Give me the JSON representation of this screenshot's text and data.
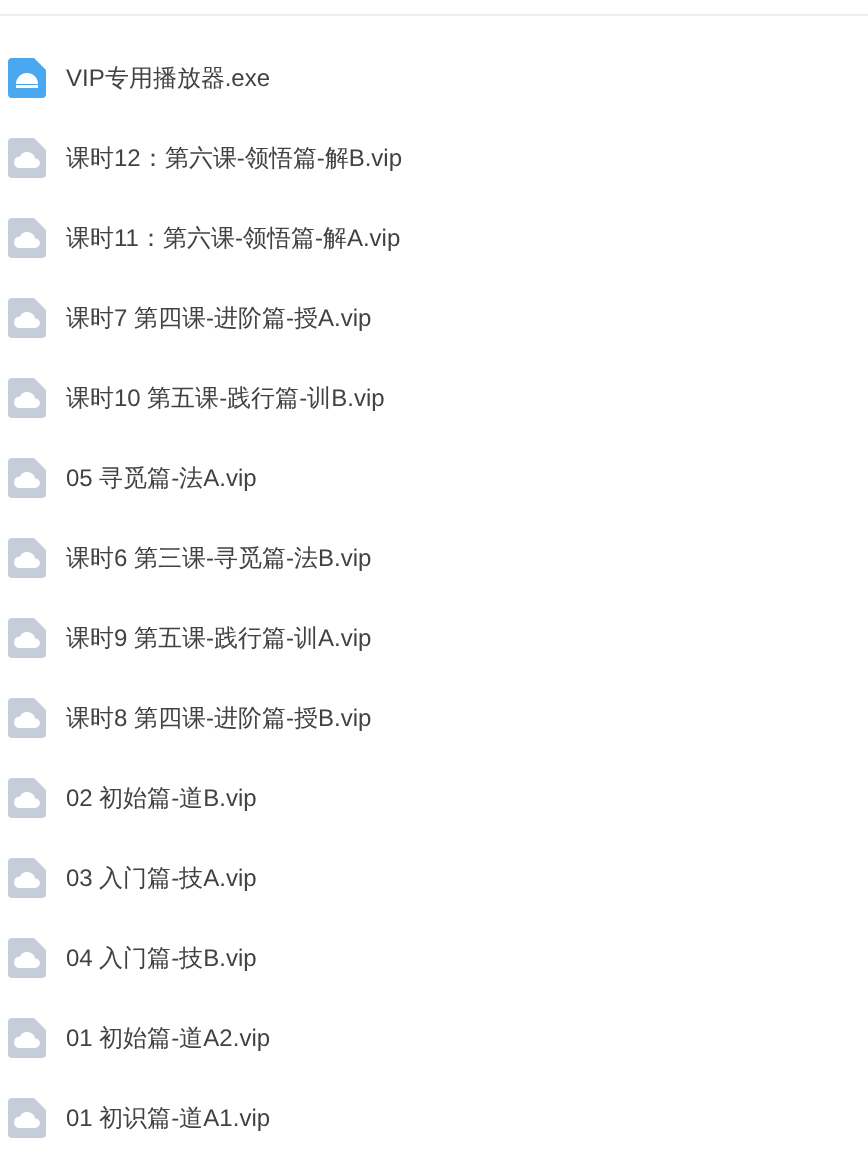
{
  "files": [
    {
      "name": "VIP专用播放器.exe",
      "kind": "app"
    },
    {
      "name": "课时12：第六课-领悟篇-解B.vip",
      "kind": "file"
    },
    {
      "name": "课时11：第六课-领悟篇-解A.vip",
      "kind": "file"
    },
    {
      "name": "课时7 第四课-进阶篇-授A.vip",
      "kind": "file"
    },
    {
      "name": "课时10 第五课-践行篇-训B.vip",
      "kind": "file"
    },
    {
      "name": "05 寻觅篇-法A.vip",
      "kind": "file"
    },
    {
      "name": "课时6 第三课-寻觅篇-法B.vip",
      "kind": "file"
    },
    {
      "name": "课时9 第五课-践行篇-训A.vip",
      "kind": "file"
    },
    {
      "name": "课时8 第四课-进阶篇-授B.vip",
      "kind": "file"
    },
    {
      "name": "02 初始篇-道B.vip",
      "kind": "file"
    },
    {
      "name": "03 入门篇-技A.vip",
      "kind": "file"
    },
    {
      "name": "04 入门篇-技B.vip",
      "kind": "file"
    },
    {
      "name": "01 初始篇-道A2.vip",
      "kind": "file"
    },
    {
      "name": "01 初识篇-道A1.vip",
      "kind": "file"
    }
  ]
}
